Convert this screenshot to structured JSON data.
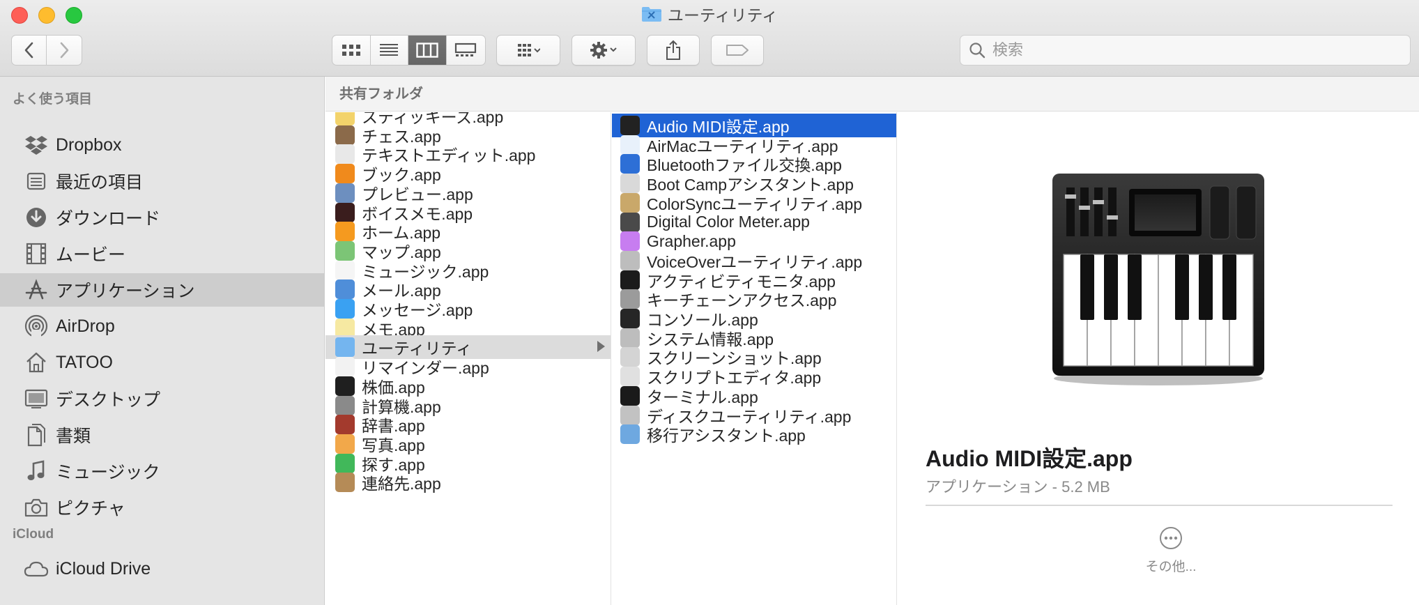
{
  "window": {
    "title": "ユーティリティ"
  },
  "toolbar": {
    "search_placeholder": "検索",
    "icons": {
      "back": "chevron-left-icon",
      "forward": "chevron-right-icon",
      "view_icons": "icon-view-icon",
      "view_list": "list-view-icon",
      "view_columns": "column-view-icon",
      "view_gallery": "gallery-view-icon",
      "group": "group-icon",
      "action": "gear-icon",
      "share": "share-icon",
      "tags": "tag-icon"
    }
  },
  "sidebar": {
    "favorites_heading": "よく使う項目",
    "icloud_heading": "iCloud",
    "items": [
      {
        "label": "Dropbox",
        "icon": "dropbox-icon"
      },
      {
        "label": "最近の項目",
        "icon": "recents-icon"
      },
      {
        "label": "ダウンロード",
        "icon": "download-icon"
      },
      {
        "label": "ムービー",
        "icon": "film-icon"
      },
      {
        "label": "アプリケーション",
        "icon": "applications-icon",
        "selected": true
      },
      {
        "label": "AirDrop",
        "icon": "airdrop-icon"
      },
      {
        "label": "TATOO",
        "icon": "home-icon"
      },
      {
        "label": "デスクトップ",
        "icon": "desktop-icon"
      },
      {
        "label": "書類",
        "icon": "documents-icon"
      },
      {
        "label": "ミュージック",
        "icon": "music-icon"
      },
      {
        "label": "ピクチャ",
        "icon": "camera-icon"
      }
    ],
    "icloud_items": [
      {
        "label": "iCloud Drive",
        "icon": "cloud-icon"
      }
    ]
  },
  "pathbar": {
    "label": "共有フォルダ"
  },
  "column1": {
    "items": [
      {
        "label": "スティッキーズ.app",
        "color": "#f3d36b"
      },
      {
        "label": "チェス.app",
        "color": "#8b6a4a"
      },
      {
        "label": "テキストエディット.app",
        "color": "#e8e8e8"
      },
      {
        "label": "ブック.app",
        "color": "#f08a1c"
      },
      {
        "label": "プレビュー.app",
        "color": "#6d8fbf"
      },
      {
        "label": "ボイスメモ.app",
        "color": "#3a1d1d"
      },
      {
        "label": "ホーム.app",
        "color": "#f59a1f"
      },
      {
        "label": "マップ.app",
        "color": "#7cc576"
      },
      {
        "label": "ミュージック.app",
        "color": "#f5f5f5"
      },
      {
        "label": "メール.app",
        "color": "#4f8ed9"
      },
      {
        "label": "メッセージ.app",
        "color": "#3aa1f2"
      },
      {
        "label": "メモ.app",
        "color": "#f6e9a2"
      },
      {
        "label": "ユーティリティ",
        "color": "#74b5ef",
        "selected": true,
        "folder": true
      },
      {
        "label": "リマインダー.app",
        "color": "#f2f2f2"
      },
      {
        "label": "株価.app",
        "color": "#1f1f1f"
      },
      {
        "label": "計算機.app",
        "color": "#8a8a8a"
      },
      {
        "label": "辞書.app",
        "color": "#a33a2d"
      },
      {
        "label": "写真.app",
        "color": "#f2a84a"
      },
      {
        "label": "探す.app",
        "color": "#41b85a"
      },
      {
        "label": "連絡先.app",
        "color": "#b58b57"
      }
    ]
  },
  "column2": {
    "items": [
      {
        "label": "Audio MIDI設定.app",
        "color": "#222222",
        "selected": true
      },
      {
        "label": "AirMacユーティリティ.app",
        "color": "#e8f1fb"
      },
      {
        "label": "Bluetoothファイル交換.app",
        "color": "#2d6fd6"
      },
      {
        "label": "Boot Campアシスタント.app",
        "color": "#d9d9d9"
      },
      {
        "label": "ColorSyncユーティリティ.app",
        "color": "#c9a86a"
      },
      {
        "label": "Digital Color Meter.app",
        "color": "#4a4a4a"
      },
      {
        "label": "Grapher.app",
        "color": "#c77df0"
      },
      {
        "label": "VoiceOverユーティリティ.app",
        "color": "#bdbdbd"
      },
      {
        "label": "アクティビティモニタ.app",
        "color": "#1b1b1b"
      },
      {
        "label": "キーチェーンアクセス.app",
        "color": "#9b9b9b"
      },
      {
        "label": "コンソール.app",
        "color": "#262626"
      },
      {
        "label": "システム情報.app",
        "color": "#bdbdbd"
      },
      {
        "label": "スクリーンショット.app",
        "color": "#d4d4d4"
      },
      {
        "label": "スクリプトエディタ.app",
        "color": "#e0e0e0"
      },
      {
        "label": "ターミナル.app",
        "color": "#1a1a1a"
      },
      {
        "label": "ディスクユーティリティ.app",
        "color": "#c2c2c2"
      },
      {
        "label": "移行アシスタント.app",
        "color": "#6ea8e0"
      }
    ]
  },
  "preview": {
    "name": "Audio MIDI設定.app",
    "meta": "アプリケーション - 5.2 MB",
    "more_label": "その他..."
  }
}
